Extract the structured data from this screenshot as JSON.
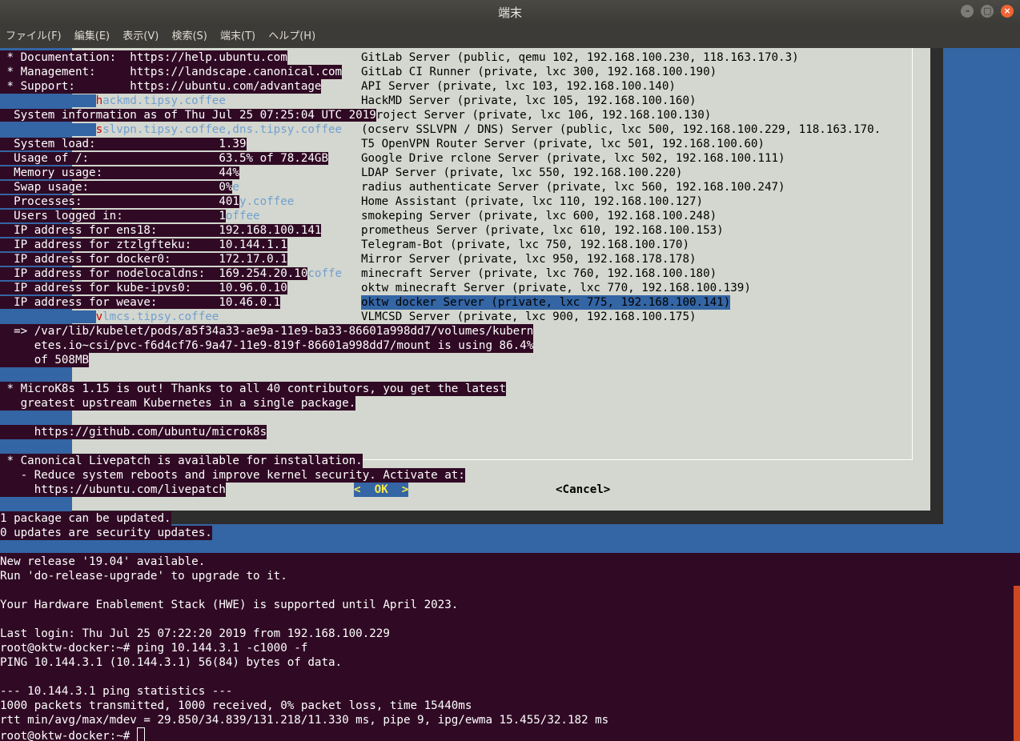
{
  "window": {
    "title": "端末",
    "controls": [
      "minimize-icon",
      "maximize-icon",
      "close-icon"
    ]
  },
  "menu": [
    "ファイル(F)",
    "編集(E)",
    "表示(V)",
    "検索(S)",
    "端末(T)",
    "ヘルプ(H)"
  ],
  "motd": {
    "doc": " * Documentation:  https://help.ubuntu.com",
    "mgmt": " * Management:     https://landscape.canonical.com",
    "support": " * Support:        https://ubuntu.com/advantage",
    "sysinfo": "  System information as of Thu Jul 25 07:25:04 UTC 2019",
    "sysload": "  System load:                  1.39",
    "usage": "  Usage of /:                   63.5% of 78.24GB",
    "mem": "  Memory usage:                 44%",
    "swap": "  Swap usage:                   0%",
    "procs": "  Processes:                    401",
    "users": "  Users logged in:              1",
    "ip_ens18": "  IP address for ens18:         192.168.100.141",
    "ip_ztzl": "  IP address for ztzlgfteku:    10.144.1.1",
    "ip_docker0": "  IP address for docker0:       172.17.0.1",
    "ip_nodelocal": "  IP address for nodelocaldns:  169.254.20.10",
    "ip_kube": "  IP address for kube-ipvs0:    10.96.0.10",
    "ip_weave": "  IP address for weave:         10.46.0.1",
    "kubelet1": "  => /var/lib/kubelet/pods/a5f34a33-ae9a-11e9-ba33-86601a998dd7/volumes/kubern",
    "kubelet2": "     etes.io~csi/pvc-f6d4cf76-9a47-11e9-819f-86601a998dd7/mount is using 86.4%",
    "kubelet3": "     of 508MB",
    "microk8s1": " * MicroK8s 1.15 is out! Thanks to all 40 contributors, you get the latest",
    "microk8s2": "   greatest upstream Kubernetes in a single package.",
    "microk8s_url": "     https://github.com/ubuntu/microk8s",
    "livepatch1": " * Canonical Livepatch is available for installation.",
    "livepatch2": "   - Reduce system reboots and improve kernel security. Activate at:",
    "livepatch3": "     https://ubuntu.com/livepatch"
  },
  "overlay_fragments": {
    "hackmd_h": "h",
    "hackmd_rest": "ackmd.tipsy.coffee",
    "sslvpn_s": "s",
    "sslvpn_rest": "slvpn.tipsy.coffee,dns.tipsy.coffee",
    "swap_tail": "e",
    "procs_tail": "y.coffee",
    "users_tail": "offee",
    "nodelocal_tail": "coffe",
    "vlmcs_v": "v",
    "vlmcs_rest": "lmcs.tipsy.coffee",
    "project_tail": "roject Server (private, lxc 106, 192.168.100.130)"
  },
  "dialog": {
    "items": [
      "GitLab Server (public, qemu 102, 192.168.100.230, 118.163.170.3)",
      "GitLab CI Runner (private, lxc 300, 192.168.100.190)",
      "API Server (private, lxc 103, 192.168.100.140)",
      "HackMD Server (private, lxc 105, 192.168.100.160)",
      "",
      "(ocserv SSLVPN / DNS) Server (public, lxc 500, 192.168.100.229, 118.163.170.",
      "T5 OpenVPN Router Server (private, lxc 501, 192.168.100.60)",
      "Google Drive rclone Server (private, lxc 502, 192.168.100.111)",
      "LDAP Server (private, lxc 550, 192.168.100.220)",
      "radius authenticate Server (private, lxc 560, 192.168.100.247)",
      "Home Assistant (private, lxc 110, 192.168.100.127)",
      "smokeping Server (private, lxc 600, 192.168.100.248)",
      "prometheus Server (private, lxc 610, 192.168.100.153)",
      "Telegram-Bot (private, lxc 750, 192.168.100.170)",
      "Mirror Server (private, lxc 950, 192.168.178.178)",
      "minecraft Server (private, lxc 760, 192.168.100.180)",
      "oktw minecraft Server (private, lxc 770, 192.168.100.139)",
      "oktw docker Server (private, lxc 775, 192.168.100.141)",
      "VLMCSD Server (private, lxc 900, 192.168.100.175)"
    ],
    "selected_index": 17,
    "ok_label": "<  OK  >",
    "cancel_label": "<Cancel>"
  },
  "shell": {
    "l1": "1 package can be updated.",
    "l2": "0 updates are security updates.",
    "l3": "New release '19.04' available.",
    "l4": "Run 'do-release-upgrade' to upgrade to it.",
    "l5": "Your Hardware Enablement Stack (HWE) is supported until April 2023.",
    "l6": "Last login: Thu Jul 25 07:22:20 2019 from 192.168.100.229",
    "l7": "root@oktw-docker:~# ping 10.144.3.1 -c1000 -f",
    "l8": "PING 10.144.3.1 (10.144.3.1) 56(84) bytes of data.",
    "l9": "--- 10.144.3.1 ping statistics ---",
    "l10": "1000 packets transmitted, 1000 received, 0% packet loss, time 15440ms",
    "l11": "rtt min/avg/max/mdev = 29.850/34.839/131.218/11.330 ms, pipe 9, ipg/ewma 15.455/32.182 ms",
    "prompt": "root@oktw-docker:~# "
  },
  "colors": {
    "terminal_bg": "#300a24",
    "dialog_bg": "#d3d7cf",
    "screen_bg": "#3465a4",
    "selection": "#3465a4",
    "ok_text": "#fce94f",
    "close_button": "#f06434"
  }
}
